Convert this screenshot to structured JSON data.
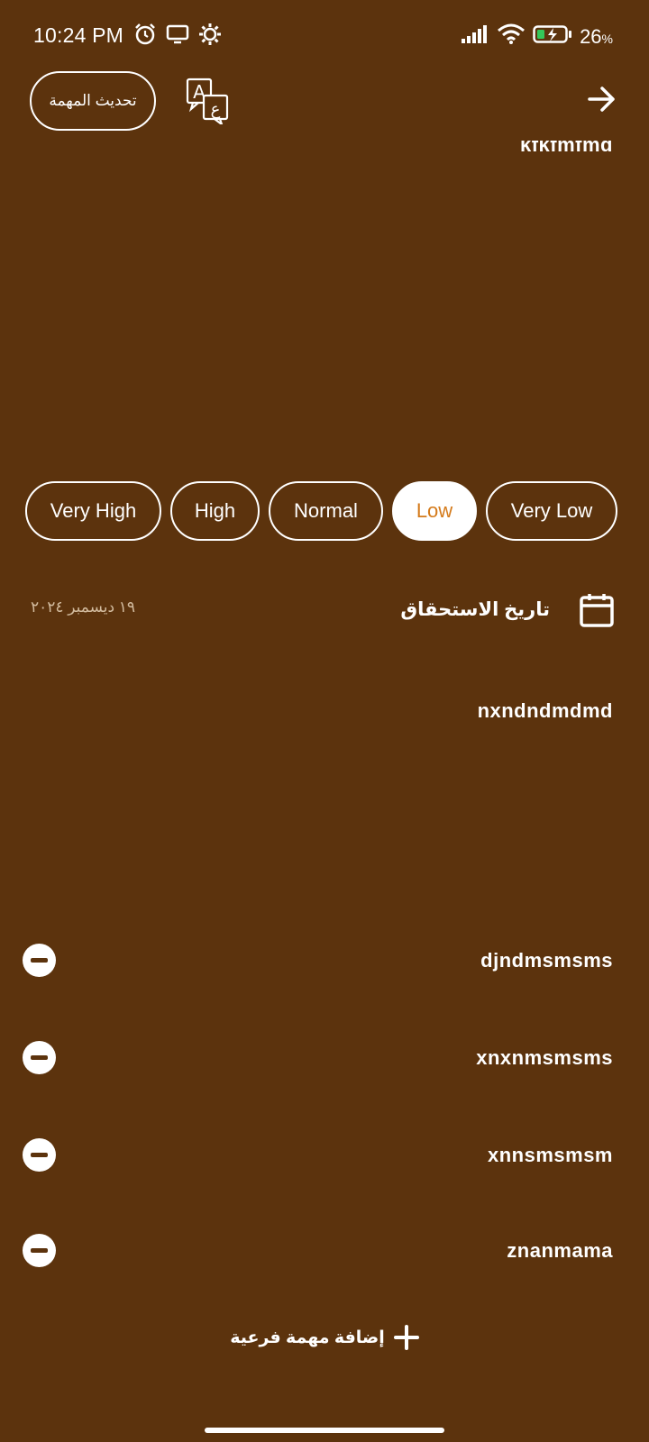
{
  "status_bar": {
    "time": "10:24 PM",
    "battery_percent": "26",
    "battery_unit": "%",
    "icons_left": [
      "alarm-icon",
      "screen-cast-icon",
      "settings-gear-icon"
    ],
    "icons_right": [
      "signal-icon",
      "wifi-icon",
      "battery-charging-icon"
    ]
  },
  "header": {
    "update_button_label": "تحديث المهمة",
    "translate_icon": "translate-icon",
    "back_icon": "arrow-right-icon"
  },
  "task": {
    "title": "kfkfmfmd",
    "description": "nxndndmdmd"
  },
  "priority": {
    "options": [
      "Very High",
      "High",
      "Normal",
      "Low",
      "Very Low"
    ],
    "selected": "Low",
    "selected_color": "#d47a1a"
  },
  "due_date": {
    "label": "تاريخ الاستحقاق",
    "value": "١٩ ديسمبر ٢٠٢٤",
    "icon": "calendar-icon"
  },
  "subtasks": {
    "items": [
      "djndmsmsms",
      "xnxnmsmsms",
      "xnnsmsmsm",
      "znanmama"
    ],
    "remove_icon": "minus-circle-icon"
  },
  "add_subtask": {
    "label": "إضافة مهمة فرعية",
    "icon": "plus-icon"
  },
  "colors": {
    "background": "#5c330d",
    "foreground": "#ffffff",
    "muted_text": "#d2bb9e"
  }
}
